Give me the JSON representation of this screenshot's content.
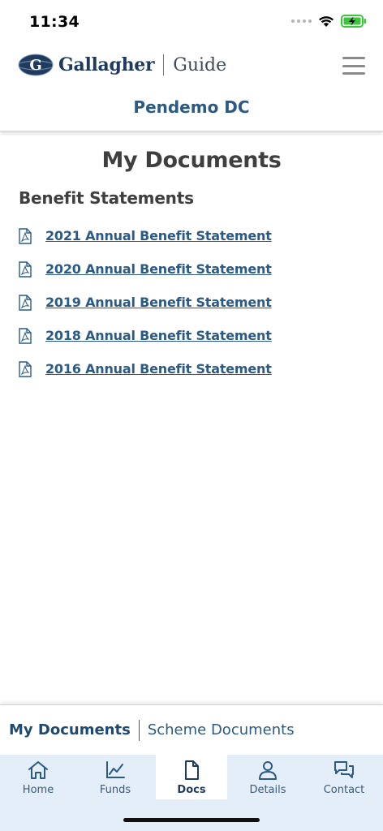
{
  "status_bar": {
    "time": "11:34"
  },
  "header": {
    "brand": "Gallagher",
    "product": "Guide",
    "subtitle": "Pendemo DC",
    "menu_icon": "hamburger-menu-icon"
  },
  "main": {
    "title": "My Documents",
    "section_title": "Benefit Statements",
    "documents": [
      {
        "label": "2021 Annual Benefit Statement",
        "icon": "pdf-file-icon"
      },
      {
        "label": "2020 Annual Benefit Statement",
        "icon": "pdf-file-icon"
      },
      {
        "label": "2019 Annual Benefit Statement",
        "icon": "pdf-file-icon"
      },
      {
        "label": "2018 Annual Benefit Statement",
        "icon": "pdf-file-icon"
      },
      {
        "label": "2016 Annual Benefit Statement",
        "icon": "pdf-file-icon"
      }
    ]
  },
  "doc_tabs": [
    {
      "label": "My Documents",
      "active": true
    },
    {
      "label": "Scheme Documents",
      "active": false
    }
  ],
  "bottom_nav": [
    {
      "label": "Home",
      "icon": "home-icon",
      "active": false
    },
    {
      "label": "Funds",
      "icon": "chart-line-icon",
      "active": false
    },
    {
      "label": "Docs",
      "icon": "document-icon",
      "active": true
    },
    {
      "label": "Details",
      "icon": "user-icon",
      "active": false
    },
    {
      "label": "Contact",
      "icon": "chat-bubbles-icon",
      "active": false
    }
  ],
  "colors": {
    "brand_navy": "#1f3a5c",
    "link_blue": "#2b5a85",
    "nav_background": "#e4eef8",
    "battery_green": "#3cc43c"
  }
}
